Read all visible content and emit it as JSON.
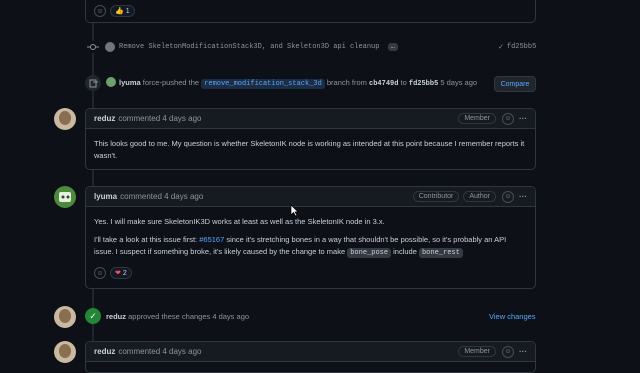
{
  "top_reactions": {
    "count": "1",
    "emoji": "👍"
  },
  "commit": {
    "message": "Remove SkeletonModificationStack3D, and Skeleton3D api cleanup",
    "ellipsis": "…",
    "sha": "fd25bb5"
  },
  "force_push": {
    "user": "lyuma",
    "action": "force-pushed the",
    "branch": "remove_modification_stack_3d",
    "branch_word": "branch from",
    "from_sha": "cb4749d",
    "to_word": "to",
    "to_sha": "fd25bb5",
    "time": "5 days ago",
    "button": "Compare"
  },
  "comment1": {
    "author": "reduz",
    "meta": "commented 4 days ago",
    "badge": "Member",
    "body": "This looks good to me. My question is whether SkeletonIK node is working as intended at this point because I remember reports it wasn't."
  },
  "comment2": {
    "author": "lyuma",
    "meta": "commented 4 days ago",
    "badges": [
      "Contributor",
      "Author"
    ],
    "p1": "Yes. I will make sure SkeletonIK3D works at least as well as the SkeletonIK node in 3.x.",
    "p2_a": "I'll take a look at this issue first: ",
    "p2_link": "#65167",
    "p2_b": " since it's stretching bones in a way that shouldn't be possible, so it's probably an API issue. I suspect if something broke, it's likely caused by the change to make ",
    "code1": "bone_pose",
    "p2_c": " include ",
    "code2": "bone_rest",
    "reaction_emoji": "❤",
    "reaction_count": "2"
  },
  "approval": {
    "user": "reduz",
    "text": "approved these changes 4 days ago",
    "button": "View changes"
  },
  "comment3": {
    "author": "reduz",
    "meta": "commented 4 days ago",
    "badge": "Member"
  },
  "colors": {
    "accent": "#58a6ff",
    "approved": "#238636",
    "background": "#0d1117"
  }
}
